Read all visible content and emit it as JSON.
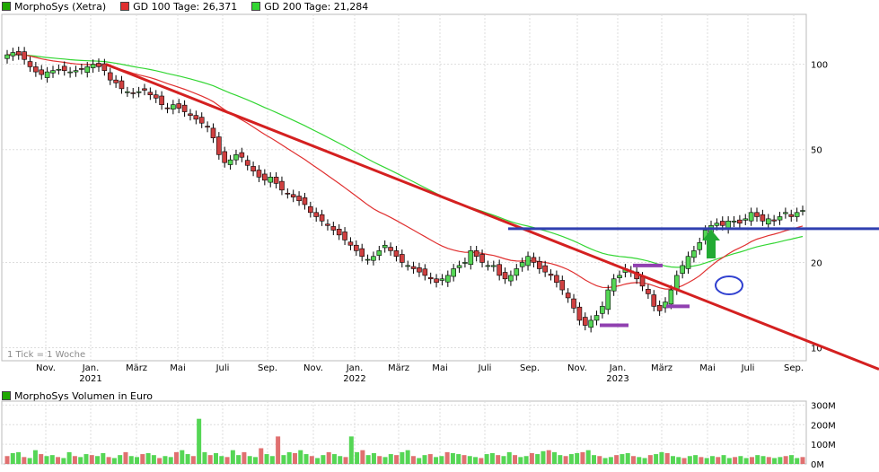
{
  "legend": {
    "price_series": {
      "label": "MorphoSys (Xetra)",
      "color": "#1fa800"
    },
    "gd100": {
      "label": "GD 100 Tage: 26,371",
      "color": "#e03030"
    },
    "gd200": {
      "label": "GD 200 Tage: 21,284",
      "color": "#33d633"
    }
  },
  "volume_legend": {
    "label": "MorphoSys Volumen in Euro",
    "color": "#1fa800"
  },
  "tick_note": "1 Tick = 1 Woche",
  "chart_data": [
    {
      "type": "candlestick",
      "title": "",
      "scale": "log",
      "ylim": [
        9,
        150
      ],
      "y_ticks": [
        {
          "value": 100,
          "label": "100"
        },
        {
          "value": 50,
          "label": "50"
        },
        {
          "value": 20,
          "label": "20"
        },
        {
          "value": 10,
          "label": "10"
        }
      ],
      "x_ticks": [
        "Nov.",
        "Jan.",
        "März",
        "Mai",
        "Juli",
        "Sep.",
        "Nov.",
        "Jan.",
        "März",
        "Mai",
        "Juli",
        "Sep.",
        "Nov.",
        "Jan.",
        "März",
        "Mai",
        "Juli",
        "Sep."
      ],
      "year_labels": [
        {
          "label": "2021",
          "under_tick": 1
        },
        {
          "label": "2022",
          "under_tick": 7
        },
        {
          "label": "2023",
          "under_tick": 13
        }
      ],
      "weekly_close": [
        108,
        110,
        108,
        104,
        98,
        94,
        92,
        94,
        95,
        96,
        95,
        94,
        95,
        96,
        98,
        100,
        98,
        95,
        88,
        86,
        82,
        80,
        79,
        80,
        81,
        78,
        76,
        72,
        70,
        72,
        70,
        68,
        66,
        64,
        62,
        60,
        55,
        48,
        45,
        46,
        48,
        47,
        44,
        42,
        40,
        39,
        40,
        38,
        36,
        35,
        34,
        33,
        32,
        30,
        29,
        28,
        27,
        26,
        25,
        24,
        23,
        22,
        21,
        20.5,
        21,
        22,
        23,
        22,
        21,
        20,
        19.5,
        19,
        18.5,
        18,
        17.5,
        17,
        17.5,
        18,
        19,
        19.5,
        20,
        22,
        21,
        20,
        19.5,
        19.5,
        18,
        17.5,
        18,
        19,
        20,
        21,
        20,
        19,
        18.5,
        18,
        17,
        16,
        15,
        13.8,
        12.5,
        12,
        12.5,
        13,
        14,
        16,
        17.5,
        18,
        19,
        18.5,
        17.5,
        16.5,
        15.5,
        14,
        13.5,
        14.5,
        16,
        18,
        19.5,
        21,
        22,
        23.5,
        26,
        27,
        27.5,
        27,
        28,
        28,
        27.5,
        28.5,
        30,
        29,
        28,
        28.5,
        28,
        29,
        30,
        29,
        30,
        30.5
      ],
      "annotations": {
        "resistance_line": 26.3,
        "support_marks": [
          12,
          14
        ],
        "top_mark": 19.5
      },
      "series": [
        {
          "name": "MorphoSys (Xetra)"
        },
        {
          "name": "GD 100 Tage: 26,371",
          "key": "gd100"
        },
        {
          "name": "GD 200 Tage: 21,284",
          "key": "gd200"
        }
      ]
    },
    {
      "type": "bar",
      "title": "",
      "y_ticks": [
        {
          "value": 300,
          "label": "300M"
        },
        {
          "value": 200,
          "label": "200M"
        },
        {
          "value": 100,
          "label": "100M"
        },
        {
          "value": 0,
          "label": "0M"
        }
      ],
      "ylim": [
        0,
        320
      ],
      "values_millions": [
        40,
        55,
        60,
        35,
        30,
        70,
        50,
        40,
        45,
        35,
        30,
        60,
        40,
        35,
        50,
        45,
        40,
        55,
        35,
        30,
        45,
        60,
        40,
        35,
        50,
        55,
        45,
        30,
        40,
        35,
        60,
        70,
        50,
        40,
        230,
        60,
        45,
        55,
        40,
        35,
        70,
        45,
        60,
        40,
        35,
        80,
        50,
        40,
        140,
        45,
        60,
        55,
        70,
        50,
        40,
        30,
        45,
        60,
        50,
        40,
        35,
        140,
        60,
        70,
        45,
        55,
        40,
        35,
        50,
        45,
        60,
        70,
        40,
        30,
        45,
        50,
        35,
        40,
        60,
        55,
        50,
        45,
        40,
        35,
        30,
        50,
        55,
        45,
        40,
        60,
        45,
        35,
        40,
        55,
        50,
        65,
        70,
        60,
        45,
        40,
        50,
        55,
        60,
        70,
        45,
        40,
        30,
        35,
        45,
        50,
        55,
        40,
        35,
        30,
        45,
        50,
        60,
        55,
        40,
        35,
        30,
        40,
        45,
        35,
        30,
        40,
        35,
        45,
        30,
        35,
        40,
        30,
        35,
        45,
        40,
        35,
        30,
        35,
        40,
        45,
        30,
        35
      ],
      "colors_up_down": {
        "up": "#55d655",
        "down": "#e07070"
      }
    }
  ]
}
